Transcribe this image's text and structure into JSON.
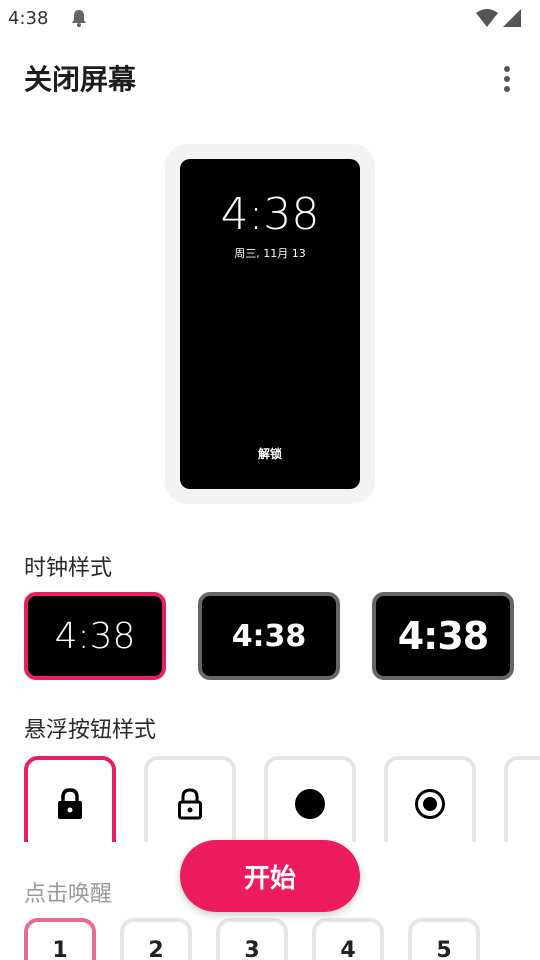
{
  "status": {
    "time": "4:38",
    "icons": [
      "notification-bell-icon",
      "wifi-icon",
      "cell-signal-icon"
    ]
  },
  "app_bar": {
    "title": "关闭屏幕",
    "overflow_icon": "more-vertical-icon"
  },
  "preview": {
    "time": "4:38",
    "date": "周三, 11月 13",
    "unlock_label": "解锁"
  },
  "clock_style": {
    "title": "时钟样式",
    "options": [
      {
        "label": "4:38",
        "selected": true
      },
      {
        "label": "4:38",
        "selected": false
      },
      {
        "label": "4:38",
        "selected": false
      }
    ]
  },
  "float_button_style": {
    "title": "悬浮按钮样式",
    "options": [
      {
        "icon": "lock-filled-icon",
        "selected": true
      },
      {
        "icon": "lock-outline-icon",
        "selected": false
      },
      {
        "icon": "circle-filled-icon",
        "selected": false
      },
      {
        "icon": "radio-dot-icon",
        "selected": false
      },
      {
        "icon": "partial-icon",
        "selected": false
      }
    ]
  },
  "fab": {
    "label": "开始"
  },
  "tap_wake": {
    "title": "点击唤醒",
    "options": [
      "1",
      "2",
      "3",
      "4",
      "5"
    ],
    "selected_index": 0
  },
  "colors": {
    "accent": "#e91e63",
    "fab": "#ec1c5f",
    "preview_bg": "#000000",
    "frame_bg": "#f3f3f3"
  }
}
